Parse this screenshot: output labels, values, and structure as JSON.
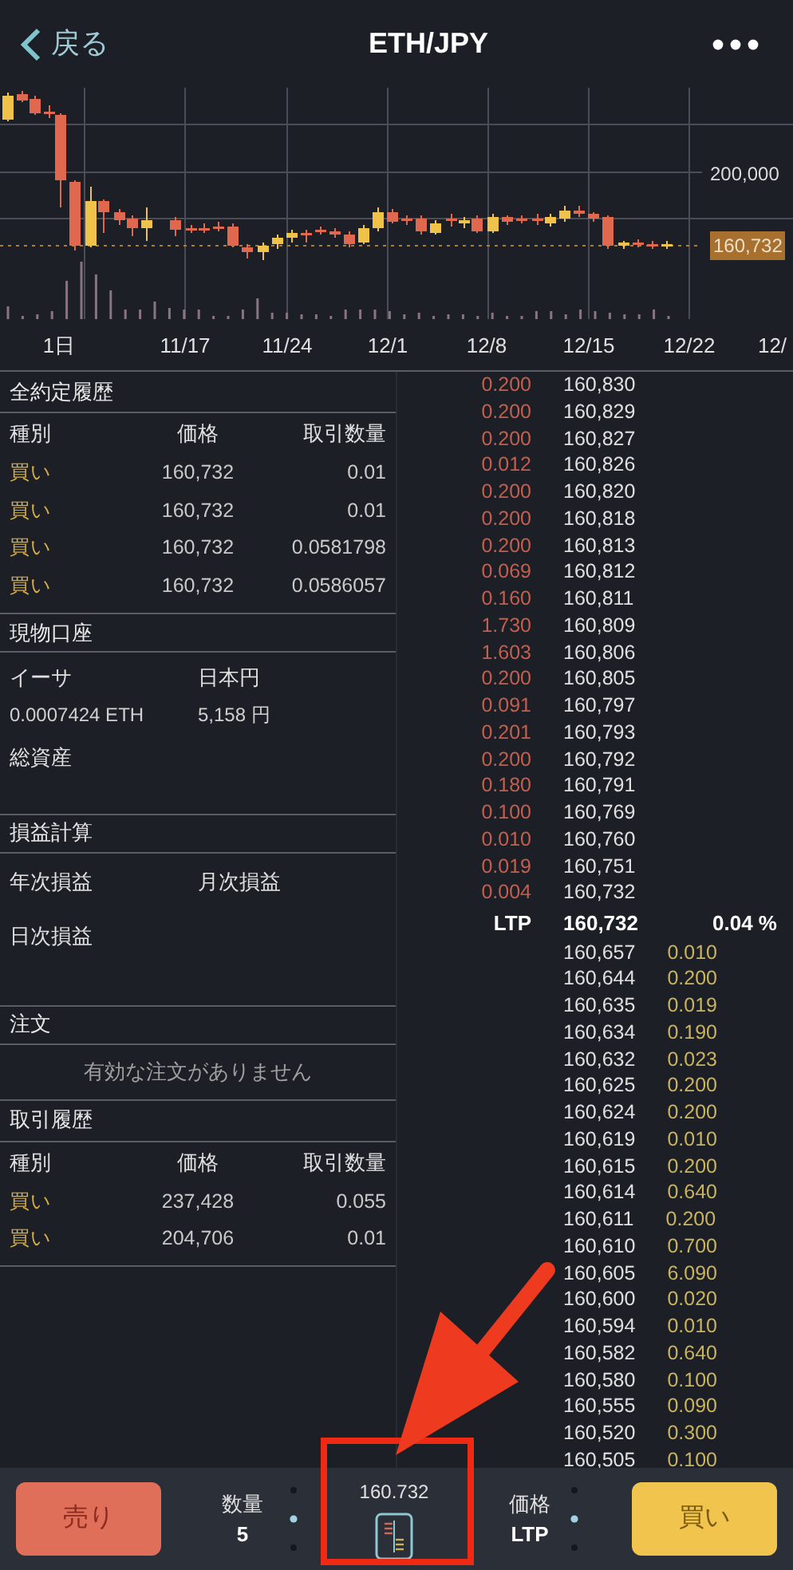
{
  "header": {
    "back_label": "戻る",
    "title": "ETH/JPY"
  },
  "chart": {
    "price_tick": "200,000",
    "current_price": "160,732",
    "date_labels": [
      "1日",
      "11/17",
      "11/24",
      "12/1",
      "12/8",
      "12/15",
      "12/22",
      "12/"
    ]
  },
  "all_trades": {
    "title": "全約定履歴",
    "columns": [
      "種別",
      "価格",
      "取引数量"
    ],
    "rows": [
      {
        "side": "買い",
        "price": "160,732",
        "amount": "0.01"
      },
      {
        "side": "買い",
        "price": "160,732",
        "amount": "0.01"
      },
      {
        "side": "買い",
        "price": "160,732",
        "amount": "0.0581798"
      },
      {
        "side": "買い",
        "price": "160,732",
        "amount": "0.0586057"
      }
    ]
  },
  "spot_account": {
    "title": "現物口座",
    "assets": [
      {
        "label": "イーサ",
        "value": "0.0007424 ETH"
      },
      {
        "label": "日本円",
        "value": "5,158 円"
      }
    ],
    "total_label": "総資産"
  },
  "pnl": {
    "title": "損益計算",
    "yearly": "年次損益",
    "monthly": "月次損益",
    "daily": "日次損益"
  },
  "orders": {
    "title": "注文",
    "empty_message": "有効な注文がありません"
  },
  "trade_history": {
    "title": "取引履歴",
    "columns": [
      "種別",
      "価格",
      "取引数量"
    ],
    "rows": [
      {
        "side": "買い",
        "price": "237,428",
        "amount": "0.055"
      },
      {
        "side": "買い",
        "price": "204,706",
        "amount": "0.01"
      }
    ]
  },
  "order_book": {
    "asks": [
      {
        "qty": "0.200",
        "price": "160,830"
      },
      {
        "qty": "0.200",
        "price": "160,829"
      },
      {
        "qty": "0.200",
        "price": "160,827"
      },
      {
        "qty": "0.012",
        "price": "160,826"
      },
      {
        "qty": "0.200",
        "price": "160,820"
      },
      {
        "qty": "0.200",
        "price": "160,818"
      },
      {
        "qty": "0.200",
        "price": "160,813"
      },
      {
        "qty": "0.069",
        "price": "160,812"
      },
      {
        "qty": "0.160",
        "price": "160,811"
      },
      {
        "qty": "1.730",
        "price": "160,809"
      },
      {
        "qty": "1.603",
        "price": "160,806"
      },
      {
        "qty": "0.200",
        "price": "160,805"
      },
      {
        "qty": "0.091",
        "price": "160,797"
      },
      {
        "qty": "0.201",
        "price": "160,793"
      },
      {
        "qty": "0.200",
        "price": "160,792"
      },
      {
        "qty": "0.180",
        "price": "160,791"
      },
      {
        "qty": "0.100",
        "price": "160,769"
      },
      {
        "qty": "0.010",
        "price": "160,760"
      },
      {
        "qty": "0.019",
        "price": "160,751"
      },
      {
        "qty": "0.004",
        "price": "160,732"
      }
    ],
    "ltp": {
      "label": "LTP",
      "price": "160,732",
      "change": "0.04 %"
    },
    "bids": [
      {
        "price": "160,657",
        "qty": "0.010"
      },
      {
        "price": "160,644",
        "qty": "0.200"
      },
      {
        "price": "160,635",
        "qty": "0.019"
      },
      {
        "price": "160,634",
        "qty": "0.190"
      },
      {
        "price": "160,632",
        "qty": "0.023"
      },
      {
        "price": "160,625",
        "qty": "0.200"
      },
      {
        "price": "160,624",
        "qty": "0.200"
      },
      {
        "price": "160,619",
        "qty": "0.010"
      },
      {
        "price": "160,615",
        "qty": "0.200"
      },
      {
        "price": "160,614",
        "qty": "0.640"
      },
      {
        "price": "160,611",
        "qty": "0.200"
      },
      {
        "price": "160,610",
        "qty": "0.700"
      },
      {
        "price": "160,605",
        "qty": "6.090"
      },
      {
        "price": "160,600",
        "qty": "0.020"
      },
      {
        "price": "160,594",
        "qty": "0.010"
      },
      {
        "price": "160,582",
        "qty": "0.640"
      },
      {
        "price": "160,580",
        "qty": "0.100"
      },
      {
        "price": "160,555",
        "qty": "0.090"
      },
      {
        "price": "160,520",
        "qty": "0.300"
      },
      {
        "price": "160,505",
        "qty": "0.100"
      }
    ]
  },
  "bottom_bar": {
    "sell_label": "売り",
    "quantity": {
      "label": "数量",
      "value": "5"
    },
    "center_price": "160.732",
    "price": {
      "label": "価格",
      "value": "LTP"
    },
    "buy_label": "買い"
  }
}
